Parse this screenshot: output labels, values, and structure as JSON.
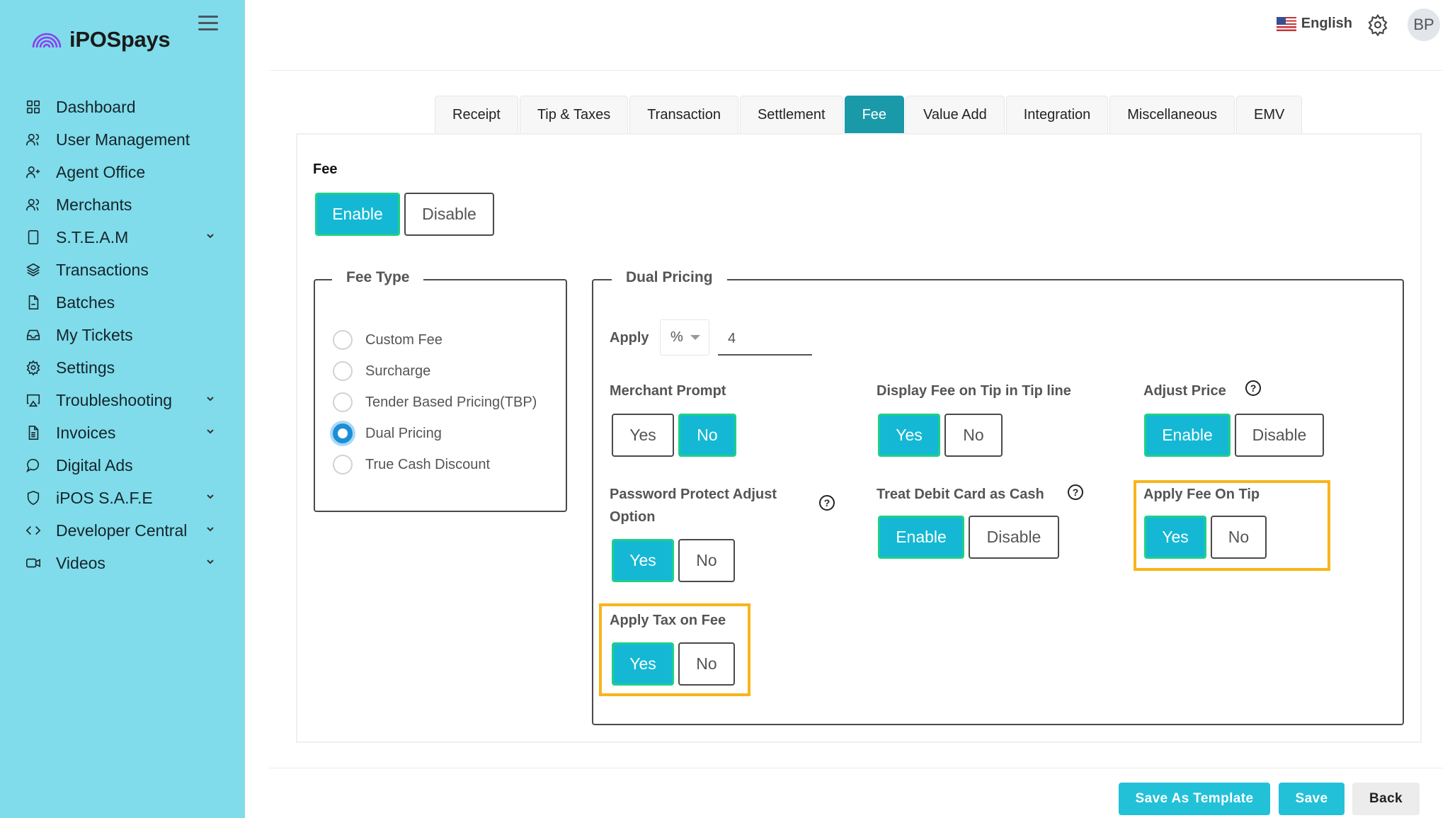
{
  "brand": {
    "name": "iPOSpays",
    "logo_icon": "rainbow-arc-icon",
    "logo_color": "#8a3ff0"
  },
  "sidebar": {
    "items": [
      {
        "label": "Dashboard",
        "icon": "grid-icon",
        "expandable": false
      },
      {
        "label": "User Management",
        "icon": "users-icon",
        "expandable": false
      },
      {
        "label": "Agent Office",
        "icon": "user-plus-icon",
        "expandable": false
      },
      {
        "label": "Merchants",
        "icon": "users-icon",
        "expandable": false
      },
      {
        "label": "S.T.E.A.M",
        "icon": "tablet-icon",
        "expandable": true
      },
      {
        "label": "Transactions",
        "icon": "layers-icon",
        "expandable": false
      },
      {
        "label": "Batches",
        "icon": "file-icon",
        "expandable": false
      },
      {
        "label": "My Tickets",
        "icon": "inbox-icon",
        "expandable": false
      },
      {
        "label": "Settings",
        "icon": "gear-icon",
        "expandable": false
      },
      {
        "label": "Troubleshooting",
        "icon": "airplay-icon",
        "expandable": true
      },
      {
        "label": "Invoices",
        "icon": "document-icon",
        "expandable": true
      },
      {
        "label": "Digital Ads",
        "icon": "chat-bubble-icon",
        "expandable": false
      },
      {
        "label": "iPOS S.A.F.E",
        "icon": "shield-icon",
        "expandable": true
      },
      {
        "label": "Developer Central",
        "icon": "code-icon",
        "expandable": true
      },
      {
        "label": "Videos",
        "icon": "video-icon",
        "expandable": true
      }
    ]
  },
  "header": {
    "language": "English",
    "avatar_initials": "BP"
  },
  "tabs": [
    {
      "label": "Receipt",
      "active": false
    },
    {
      "label": "Tip & Taxes",
      "active": false
    },
    {
      "label": "Transaction",
      "active": false
    },
    {
      "label": "Settlement",
      "active": false
    },
    {
      "label": "Fee",
      "active": true
    },
    {
      "label": "Value Add",
      "active": false
    },
    {
      "label": "Integration",
      "active": false
    },
    {
      "label": "Miscellaneous",
      "active": false
    },
    {
      "label": "EMV",
      "active": false
    }
  ],
  "fee": {
    "label": "Fee",
    "options": [
      "Enable",
      "Disable"
    ],
    "selected": "Enable"
  },
  "fee_type": {
    "legend": "Fee Type",
    "options": [
      "Custom Fee",
      "Surcharge",
      "Tender Based Pricing(TBP)",
      "Dual Pricing",
      "True Cash Discount"
    ],
    "selected": "Dual Pricing"
  },
  "dual_pricing": {
    "legend": "Dual Pricing",
    "apply_label": "Apply",
    "apply_unit": "%",
    "apply_value": "4",
    "merchant_prompt": {
      "label": "Merchant Prompt",
      "options": [
        "Yes",
        "No"
      ],
      "selected": "No"
    },
    "display_fee_on_tip": {
      "label": "Display Fee on Tip in Tip line",
      "options": [
        "Yes",
        "No"
      ],
      "selected": "Yes"
    },
    "adjust_price": {
      "label": "Adjust Price",
      "options": [
        "Enable",
        "Disable"
      ],
      "selected": "Enable",
      "help": "?"
    },
    "password_protect": {
      "label": "Password Protect Adjust Option",
      "options": [
        "Yes",
        "No"
      ],
      "selected": "Yes",
      "help": "?"
    },
    "treat_debit_as_cash": {
      "label": "Treat Debit Card as Cash",
      "options": [
        "Enable",
        "Disable"
      ],
      "selected": "Enable",
      "help": "?"
    },
    "apply_fee_on_tip": {
      "label": "Apply Fee On Tip",
      "options": [
        "Yes",
        "No"
      ],
      "selected": "Yes",
      "highlighted": true
    },
    "apply_tax_on_fee": {
      "label": "Apply Tax on Fee",
      "options": [
        "Yes",
        "No"
      ],
      "selected": "Yes",
      "highlighted": true
    }
  },
  "actions": {
    "save_template": "Save As Template",
    "save": "Save",
    "back": "Back"
  },
  "colors": {
    "sidebar_bg": "#80dcea",
    "active_tab": "#1a9aa8",
    "toggle_on": "#14b8d4",
    "toggle_on_border": "#1fcf8a",
    "highlight": "#f8b51a",
    "primary_button": "#22c1d8"
  }
}
